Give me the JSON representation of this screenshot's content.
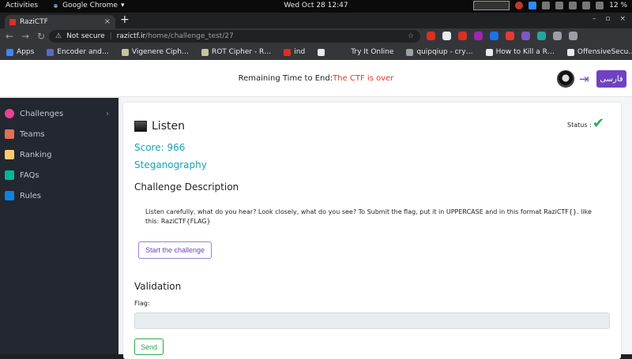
{
  "os_bar": {
    "activities": "Activities",
    "app_name": "Google Chrome",
    "app_menu_arrow": "▾",
    "clock": "Wed Oct 28  12:47",
    "battery": "12 %"
  },
  "browser": {
    "tab_title": "RaziCTF",
    "tab_close": "×",
    "new_tab": "+",
    "window_controls": [
      "–",
      "▫",
      "×"
    ],
    "nav": {
      "back": "←",
      "forward": "→",
      "reload": "↻"
    },
    "security_icon": "⚠",
    "security_label": "Not secure",
    "url_host": "razictf.ir",
    "url_path": "/home/challenge_test/27",
    "star": "☆",
    "extension_colors": [
      "#d93025",
      "#e8eaed",
      "#d93025",
      "#9c27b0",
      "#1a73e8",
      "#e53935",
      "#7e57c2",
      "#26a69a",
      "#9aa0a6",
      "#9aa0a6"
    ],
    "bookmarks": [
      {
        "label": "Apps",
        "color": "#4285f4"
      },
      {
        "label": "Encoder and…",
        "color": "#5c6bc0"
      },
      {
        "label": "Vigenere Ciph…",
        "color": "#c5c5a0"
      },
      {
        "label": "ROT Cipher - R…",
        "color": "#c5c5a0"
      },
      {
        "label": "ind",
        "color": "#d93025"
      },
      {
        "label": "",
        "color": "#e8eaed"
      },
      {
        "label": "Try It Online",
        "color": "#35363a"
      },
      {
        "label": "quipqiup - cry…",
        "color": "#9aa0a6"
      },
      {
        "label": "How to Kill a R…",
        "color": "#e8eaed"
      },
      {
        "label": "OffensiveSecu…",
        "color": "#e8eaed"
      }
    ]
  },
  "header": {
    "remaining_label": "Remaining Time to End:",
    "remaining_value": "The CTF is over",
    "logout_icon": "⇥",
    "language_button": "فارسی"
  },
  "sidebar": {
    "items": [
      {
        "label": "Challenges",
        "icon": "target-icon",
        "color": "#e84393",
        "chevron": "›"
      },
      {
        "label": "Teams",
        "icon": "team-icon",
        "color": "#e17055"
      },
      {
        "label": "Ranking",
        "icon": "trophy-icon",
        "color": "#fdcb6e"
      },
      {
        "label": "FAQs",
        "icon": "faq-icon",
        "color": "#00b894"
      },
      {
        "label": "Rules",
        "icon": "rules-icon",
        "color": "#0984e3"
      }
    ]
  },
  "challenge": {
    "title": "Listen",
    "status_label": "Status :",
    "status_icon": "✔",
    "score": "Score: 966",
    "category": "Steganography",
    "description_heading": "Challenge Description",
    "description": "Listen carefully, what do you hear? Look closely, what do you see? To Submit the flag, put it in UPPERCASE and in this format RaziCTF{}. like this: RaziCTF{FLAG}",
    "start_button": "Start the challenge"
  },
  "validation": {
    "heading": "Validation",
    "flag_label": "Flag:",
    "flag_value": "",
    "send_button": "Send"
  }
}
